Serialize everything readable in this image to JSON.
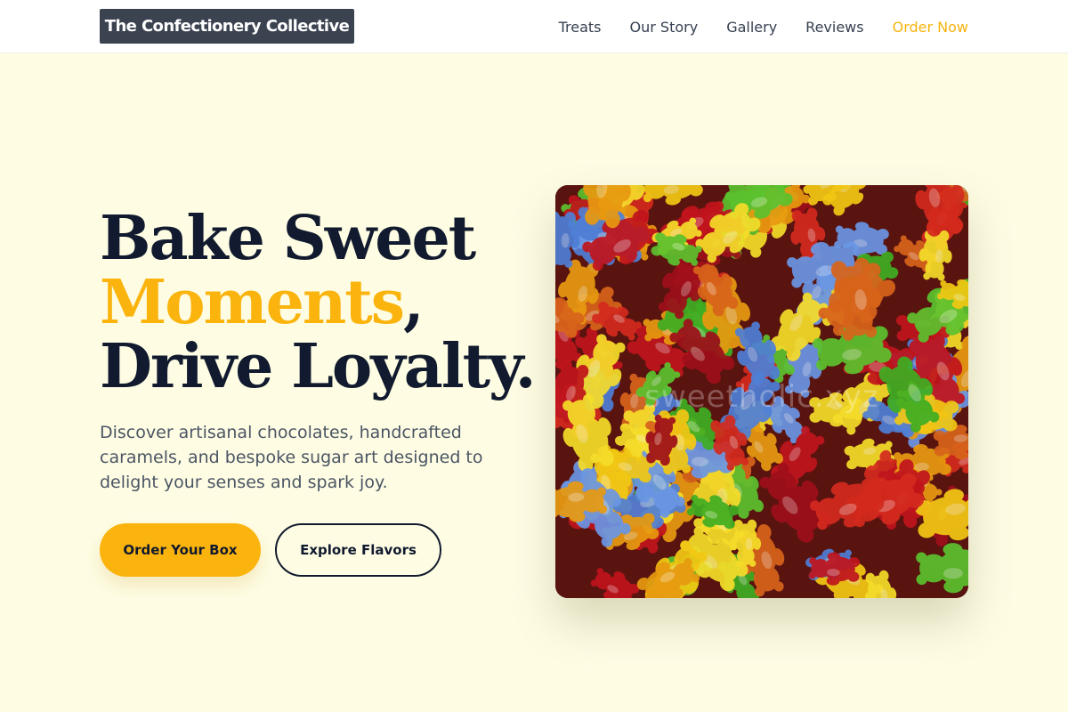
{
  "header": {
    "brand": "The Confectionery Collective",
    "nav": [
      {
        "label": "Treats"
      },
      {
        "label": "Our Story"
      },
      {
        "label": "Gallery"
      },
      {
        "label": "Reviews"
      },
      {
        "label": "Order Now"
      }
    ]
  },
  "hero": {
    "headline_line1": "Bake Sweet",
    "headline_accent": "Moments",
    "headline_comma": ",",
    "headline_line3": "Drive Loyalty.",
    "subtext": "Discover artisanal chocolates, handcrafted caramels, and bespoke sugar art designed to delight your senses and spark joy.",
    "primary_cta": "Order Your Box",
    "secondary_cta": "Explore Flavors",
    "image_watermark": "sweetholic.xyz"
  },
  "colors": {
    "accent": "#fbb40d",
    "background": "#fefde4",
    "heading": "#111a2e",
    "brand_bg": "#3b4250"
  }
}
